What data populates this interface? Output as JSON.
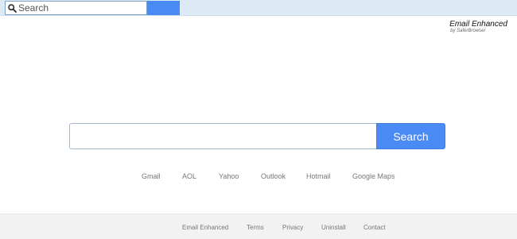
{
  "toolbar": {
    "search_placeholder": "Search",
    "search_icon": "magnifier-icon",
    "search_button_color": "#4a8af4"
  },
  "brand": {
    "title": "Email Enhanced",
    "subtitle": "by SaferBrowser"
  },
  "main_search": {
    "input_value": "",
    "button_label": "Search",
    "button_color": "#4a8af4"
  },
  "quick_links": [
    {
      "label": "Gmail"
    },
    {
      "label": "AOL"
    },
    {
      "label": "Yahoo"
    },
    {
      "label": "Outlook"
    },
    {
      "label": "Hotmail"
    },
    {
      "label": "Google Maps"
    }
  ],
  "footer": {
    "links": [
      {
        "label": "Email Enhanced"
      },
      {
        "label": "Terms"
      },
      {
        "label": "Privacy"
      },
      {
        "label": "Uninstall"
      },
      {
        "label": "Contact"
      }
    ]
  }
}
